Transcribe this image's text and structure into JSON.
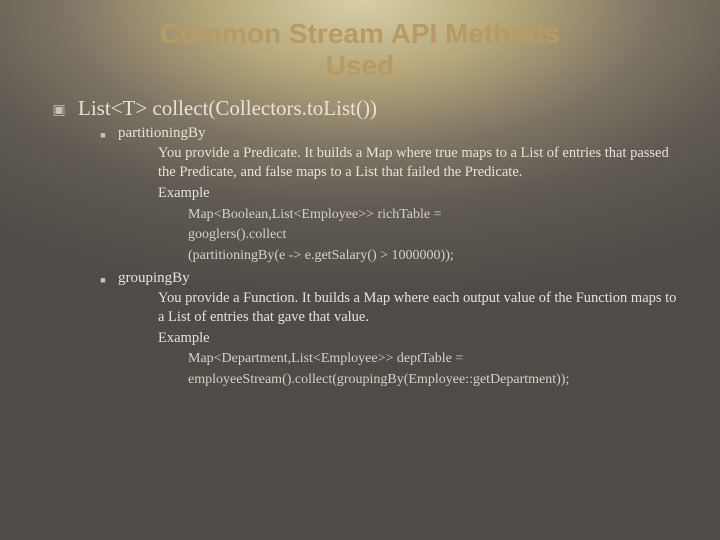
{
  "title_line1": "Common Stream API Methods",
  "title_line2": "Used",
  "h1": "List<T> collect(Collectors.toList())",
  "p1": {
    "name": "partitioningBy",
    "desc": "You provide a Predicate. It builds a Map where true maps to a List of entries that passed the Predicate, and false maps to a List that failed the Predicate.",
    "example_label": "Example",
    "code1": "Map<Boolean,List<Employee>> richTable =",
    "code2": "googlers().collect",
    "code3": "(partitioningBy(e -> e.getSalary() > 1000000));"
  },
  "p2": {
    "name": "groupingBy",
    "desc": "You provide a Function. It builds a Map where each output value of the Function maps to a List of entries that gave that value.",
    "example_label": "Example",
    "code1": "Map<Department,List<Employee>> deptTable =",
    "code2": "employeeStream().collect(groupingBy(Employee::getDepartment));"
  }
}
